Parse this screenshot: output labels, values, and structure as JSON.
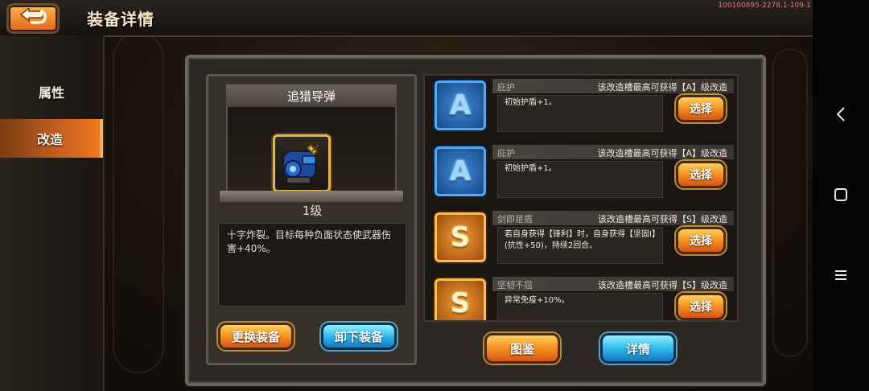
{
  "header": {
    "title": "装备详情",
    "version": "100100895-2278.1-109-1"
  },
  "sidebar": {
    "items": [
      {
        "label": "属性"
      },
      {
        "label": "改造"
      }
    ]
  },
  "equipment": {
    "name": "追猎导弹",
    "level": "1级",
    "description": "十字炸裂。目标每种负面状态使武器伤害+40%。",
    "replace_button": "更换装备",
    "unequip_button": "卸下装备"
  },
  "slots": [
    {
      "grade": "A",
      "name": "庇护",
      "note": "该改造槽最高可获得【A】级改造",
      "effect": "初始护盾+1。",
      "button": "选择"
    },
    {
      "grade": "A",
      "name": "庇护",
      "note": "该改造槽最高可获得【A】级改造",
      "effect": "初始护盾+1。",
      "button": "选择"
    },
    {
      "grade": "S",
      "name": "剑即是盾",
      "note": "该改造槽最高可获得【S】级改造",
      "effect": "若自身获得【锋利】时，自身获得【坚固Ⅰ】(抗性+50)，持续2回合。",
      "button": "选择"
    },
    {
      "grade": "S",
      "name": "坚韧不屈",
      "note": "该改造槽最高可获得【S】级改造",
      "effect": "异常免疫+10%。",
      "button": "选择"
    }
  ],
  "footer": {
    "codex_button": "图鉴",
    "details_button": "详情"
  }
}
